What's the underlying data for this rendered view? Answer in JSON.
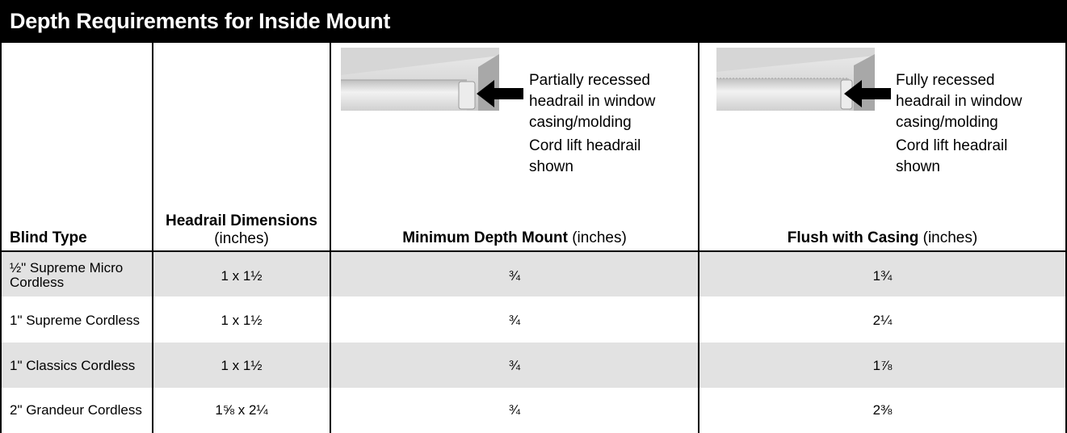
{
  "title": "Depth Requirements for Inside Mount",
  "headers": {
    "blind_type": "Blind Type",
    "headrail_bold": "Headrail Dimensions",
    "headrail_units": "(inches)",
    "min_depth_bold": "Minimum Depth Mount",
    "min_depth_units": "(inches)",
    "flush_bold": "Flush with Casing",
    "flush_units": "(inches)"
  },
  "illustrations": {
    "partial": {
      "line1": "Partially recessed",
      "line2": "headrail in window",
      "line3": "casing/molding",
      "line4": "Cord lift headrail",
      "line5": "shown"
    },
    "full": {
      "line1": "Fully recessed",
      "line2": "headrail in window",
      "line3": "casing/molding",
      "line4": "Cord lift headrail",
      "line5": "shown"
    }
  },
  "rows": [
    {
      "blind_line1": "½\" Supreme Micro",
      "blind_line2": "Cordless",
      "headrail": "1 x 1½",
      "min_depth": "¾",
      "flush": "1¾"
    },
    {
      "blind_line1": "1\" Supreme Cordless",
      "blind_line2": "",
      "headrail": "1 x 1½",
      "min_depth": "¾",
      "flush": "2¼"
    },
    {
      "blind_line1": "1\" Classics Cordless",
      "blind_line2": "",
      "headrail": "1 x 1½",
      "min_depth": "¾",
      "flush": "1⅞"
    },
    {
      "blind_line1": "2\" Grandeur Cordless",
      "blind_line2": "",
      "headrail": "1⅝ x 2¼",
      "min_depth": "¾",
      "flush": "2⅜"
    }
  ],
  "colors": {
    "title_bg": "#000000",
    "title_fg": "#ffffff",
    "row_alt": "#e2e2e2"
  }
}
